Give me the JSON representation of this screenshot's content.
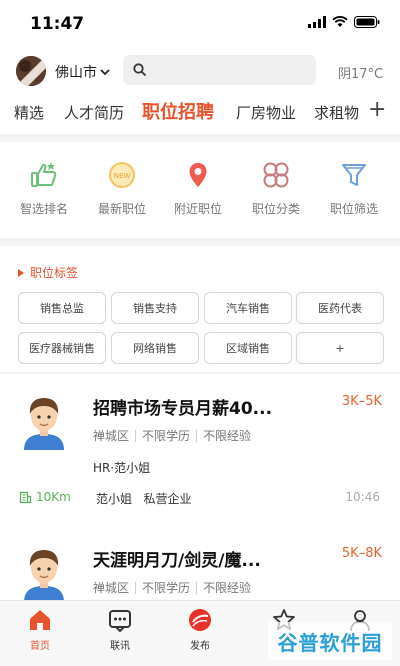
{
  "status_bar": {
    "time": "11:47"
  },
  "header": {
    "city": "佛山市",
    "search_placeholder": "",
    "weather": "阴17°C"
  },
  "tabs": [
    {
      "label": "精选",
      "active": false
    },
    {
      "label": "人才简历",
      "active": false
    },
    {
      "label": "职位招聘",
      "active": true
    },
    {
      "label": "厂房物业",
      "active": false
    },
    {
      "label": "求租物",
      "active": false
    }
  ],
  "tabs_more": "+",
  "quick_actions": [
    {
      "label": "智选排名",
      "icon": "thumbs-up-icon",
      "active": false
    },
    {
      "label": "最新职位",
      "icon": "new-badge-icon",
      "active": true
    },
    {
      "label": "附近职位",
      "icon": "location-pin-icon",
      "active": false
    },
    {
      "label": "职位分类",
      "icon": "category-icon",
      "active": false
    },
    {
      "label": "职位筛选",
      "icon": "filter-icon",
      "active": false
    }
  ],
  "section": {
    "title": "职位标签"
  },
  "tags": [
    "销售总监",
    "销售支持",
    "汽车销售",
    "医药代表",
    "医疗器械销售",
    "网络销售",
    "区域销售",
    "+"
  ],
  "jobs": [
    {
      "title": "招聘市场专员月薪40...",
      "salary": "3K–5K",
      "tags": [
        "禅城区",
        "不限学历",
        "不限经验"
      ],
      "hr": "HR·范小姐",
      "distance": "10Km",
      "company": "范小姐   私营企业",
      "time": "10:46"
    },
    {
      "title": "天涯明月刀/剑灵/魔...",
      "salary": "5K–8K",
      "tags": [
        "禅城区",
        "不限学历",
        "不限经验"
      ]
    }
  ],
  "bottom_nav": [
    {
      "label": "首页",
      "icon": "home-icon",
      "active": true
    },
    {
      "label": "联讯",
      "icon": "message-icon",
      "active": false
    },
    {
      "label": "发布",
      "icon": "publish-icon",
      "active": false
    },
    {
      "label": "",
      "icon": "star-icon",
      "active": false
    },
    {
      "label": "",
      "icon": "user-icon",
      "active": false
    }
  ],
  "watermark": "谷普软件园",
  "colors": {
    "accent": "#e8522a",
    "active_blue": "#2f6bc9",
    "green": "#58b05a"
  }
}
